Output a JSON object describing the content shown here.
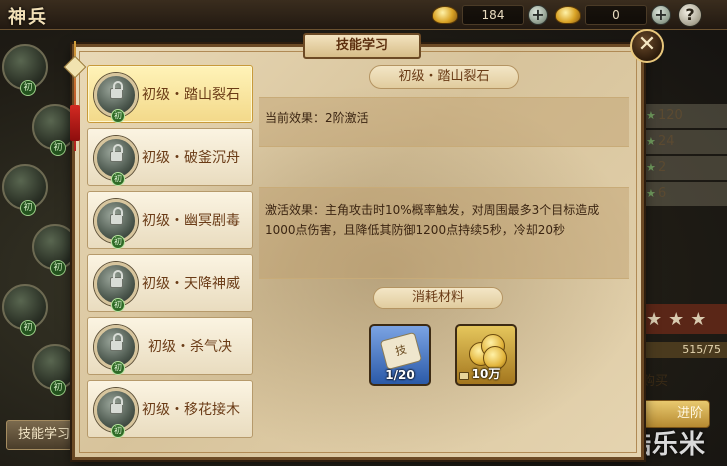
{
  "topbar": {
    "title": "神兵",
    "currency_1": "184",
    "currency_2": "0",
    "plus": "+",
    "help": "?"
  },
  "background": {
    "orb_badge": "初",
    "learn_button": "技能学习",
    "stats": [
      "120",
      "24",
      "2",
      "6"
    ],
    "progress": "515/75",
    "buy_label": "购买",
    "advance_label": "进阶",
    "watermark": "酷乐米"
  },
  "modal": {
    "title": "技能学习",
    "close": "✕",
    "skills": [
      {
        "name": "初级・踏山裂石",
        "badge": "初",
        "selected": true
      },
      {
        "name": "初级・破釜沉舟",
        "badge": "初",
        "selected": false
      },
      {
        "name": "初级・幽冥剧毒",
        "badge": "初",
        "selected": false
      },
      {
        "name": "初级・天降神威",
        "badge": "初",
        "selected": false
      },
      {
        "name": "初级・杀气决",
        "badge": "初",
        "selected": false
      },
      {
        "name": "初级・移花接木",
        "badge": "初",
        "selected": false
      }
    ],
    "detail": {
      "title": "初级・踏山裂石",
      "current_effect": "当前效果：2阶激活",
      "activate_effect": "激活效果：主角攻击时10%概率触发，对周围最多3个目标造成1000点伤害，且降低其防御1200点持续5秒，冷却20秒",
      "materials_label": "消耗材料",
      "materials": [
        {
          "icon": "skill-scroll-icon",
          "art": "技",
          "count": "1/20"
        },
        {
          "icon": "gold-coins-icon",
          "count": "10万"
        }
      ]
    }
  },
  "colors": {
    "panel_border": "#6c4a25",
    "skill_text": "#6a3b16",
    "selected_bg": "#f3d98a",
    "badge_green": "#2f6b27"
  }
}
